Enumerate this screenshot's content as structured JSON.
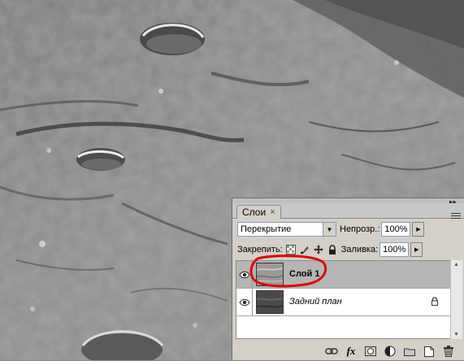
{
  "panel": {
    "tab_label": "Слои",
    "tab_close": "×",
    "blend_mode": "Перекрытие",
    "opacity_label": "Непрозр.:",
    "opacity_value": "100%",
    "lock_label": "Закрепить:",
    "fill_label": "Заливка:",
    "fill_value": "100%"
  },
  "layers": [
    {
      "name": "Слой 1",
      "selected": true,
      "visible": true
    },
    {
      "name": "Задний план",
      "selected": false,
      "visible": true,
      "locked": true
    }
  ],
  "colors": {
    "annotation_circle": "#e00000",
    "panel_bg": "#d4d0c8",
    "selected_row": "#b5b5b5"
  },
  "icons": {
    "bottom_bar": [
      "link-layers-icon",
      "fx-icon",
      "layer-mask-icon",
      "adjustment-layer-icon",
      "new-group-icon",
      "new-layer-icon",
      "delete-layer-icon"
    ],
    "fx_glyph": "fx"
  }
}
